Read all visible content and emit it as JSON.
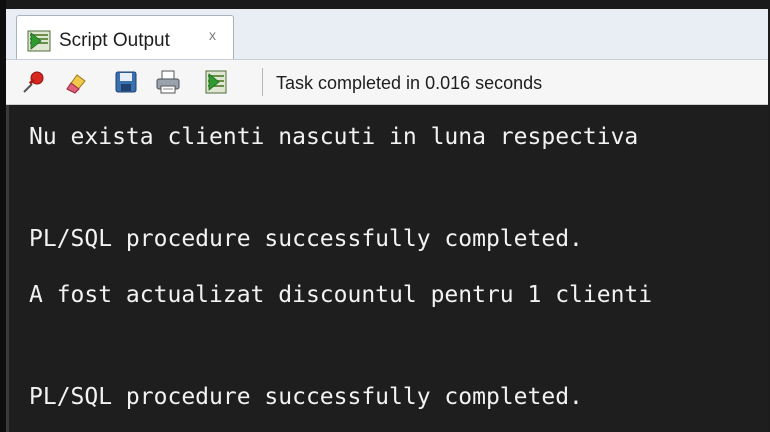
{
  "tab": {
    "label": "Script Output",
    "close_label": "x",
    "icon": "script-output-icon"
  },
  "toolbar": {
    "buttons": [
      {
        "name": "pin-icon"
      },
      {
        "name": "eraser-icon"
      },
      {
        "name": "save-icon"
      },
      {
        "name": "print-icon"
      },
      {
        "name": "run-script-icon"
      }
    ],
    "status": "Task completed in 0.016 seconds"
  },
  "output": {
    "lines": [
      "Nu exista clienti nascuti in luna respectiva",
      "PL/SQL procedure successfully completed.",
      "A fost actualizat discountul pentru 1 clienti",
      "PL/SQL procedure successfully completed."
    ]
  },
  "colors": {
    "console_bg": "#1e1e1e",
    "console_text": "#f2f2f2",
    "tab_bg": "#ffffff",
    "toolbar_bg": "#f6f6f6"
  }
}
